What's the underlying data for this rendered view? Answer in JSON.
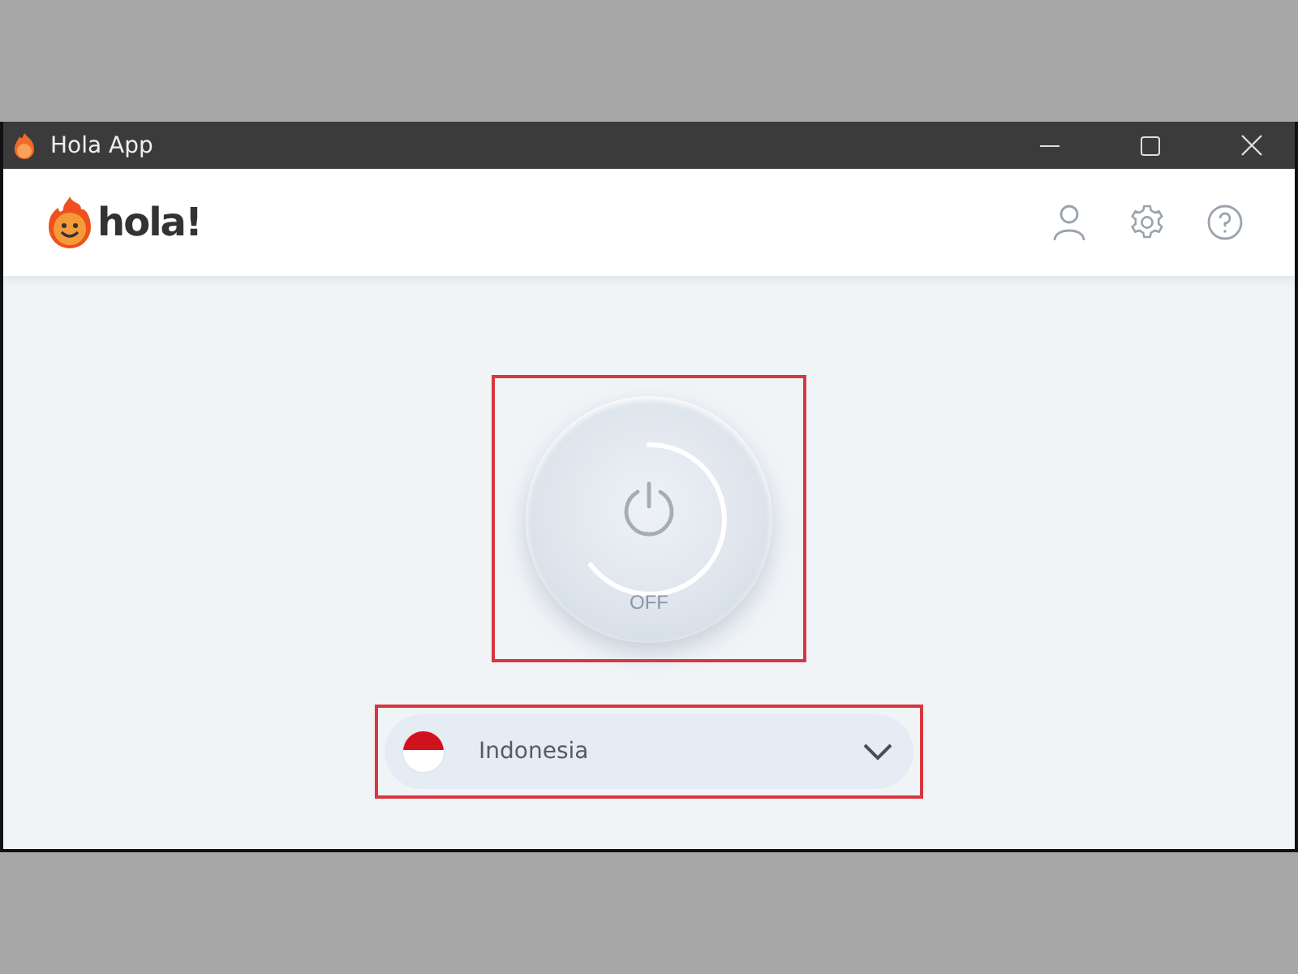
{
  "window": {
    "title": "Hola App"
  },
  "header": {
    "logo_text": "hola!"
  },
  "power": {
    "on": false,
    "label": "OFF"
  },
  "country": {
    "name": "Indonesia",
    "expanded": false
  }
}
